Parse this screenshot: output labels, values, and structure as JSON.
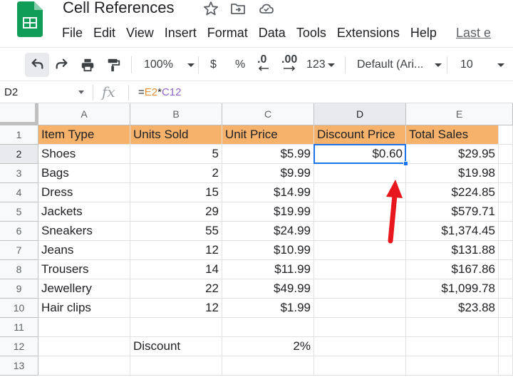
{
  "app": {
    "doc_title": "Cell References",
    "colors": {
      "accent": "#1a73e8",
      "header_fill": "#f6b26b",
      "arrow": "#e8171d",
      "logo": "#0f9d58"
    }
  },
  "menu": [
    "File",
    "Edit",
    "View",
    "Insert",
    "Format",
    "Data",
    "Tools",
    "Extensions",
    "Help"
  ],
  "last_edit": "Last e",
  "toolbar": {
    "zoom": "100%",
    "currency": "$",
    "percent": "%",
    "dec_decrease": ".0",
    "dec_increase": ".00",
    "more_formats": "123",
    "font": "Default (Ari...",
    "font_size": "10"
  },
  "formula_bar": {
    "name_box": "D2",
    "fx": "fx",
    "formula_prefix": "=",
    "ref1": "E2",
    "op": "*",
    "ref2": "C12"
  },
  "columns": [
    "A",
    "B",
    "C",
    "D",
    "E"
  ],
  "selected_column": "D",
  "rows": [
    "1",
    "2",
    "3",
    "4",
    "5",
    "6",
    "7",
    "8",
    "9",
    "10",
    "11",
    "12",
    "13"
  ],
  "selected_row": "2",
  "sheet": {
    "headers": [
      "Item Type",
      "Units Sold",
      "Unit Price",
      "Discount Price",
      "Total Sales"
    ],
    "data": [
      [
        "Shoes",
        "5",
        "$5.99",
        "$0.60",
        "$29.95"
      ],
      [
        "Bags",
        "2",
        "$9.99",
        "",
        "$19.98"
      ],
      [
        "Dress",
        "15",
        "$14.99",
        "",
        "$224.85"
      ],
      [
        "Jackets",
        "29",
        "$19.99",
        "",
        "$579.71"
      ],
      [
        "Sneakers",
        "55",
        "$24.99",
        "",
        "$1,374.45"
      ],
      [
        "Jeans",
        "12",
        "$10.99",
        "",
        "$131.88"
      ],
      [
        "Trousers",
        "14",
        "$11.99",
        "",
        "$167.86"
      ],
      [
        "Jewellery",
        "22",
        "$49.99",
        "",
        "$1,099.78"
      ],
      [
        "Hair clips",
        "12",
        "$1.99",
        "",
        "$23.88"
      ],
      [
        "",
        "",
        "",
        "",
        ""
      ],
      [
        "",
        "Discount",
        "2%",
        "",
        ""
      ],
      [
        "",
        "",
        "",
        "",
        ""
      ]
    ]
  }
}
